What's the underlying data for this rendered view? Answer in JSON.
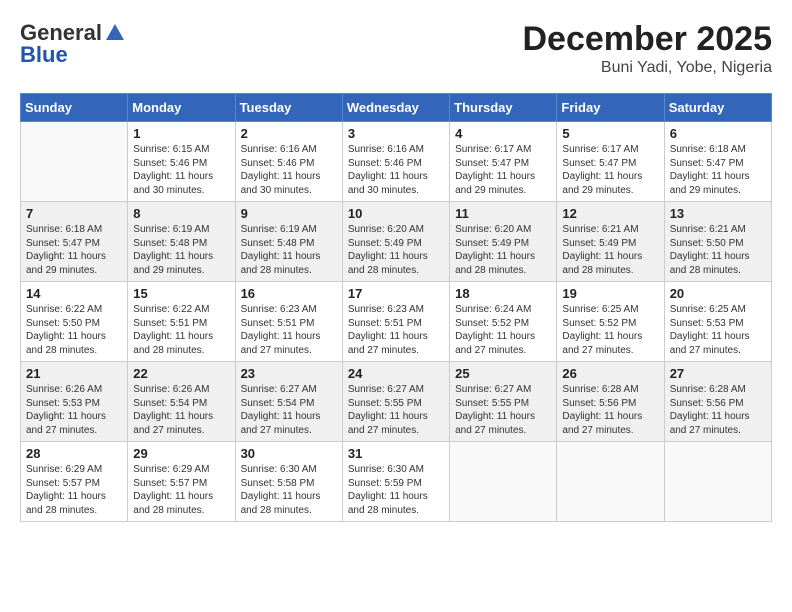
{
  "header": {
    "logo_general": "General",
    "logo_blue": "Blue",
    "title": "December 2025",
    "subtitle": "Buni Yadi, Yobe, Nigeria"
  },
  "weekdays": [
    "Sunday",
    "Monday",
    "Tuesday",
    "Wednesday",
    "Thursday",
    "Friday",
    "Saturday"
  ],
  "weeks": [
    [
      {
        "day": "",
        "empty": true
      },
      {
        "day": "1",
        "sunrise": "6:15 AM",
        "sunset": "5:46 PM",
        "daylight": "11 hours and 30 minutes."
      },
      {
        "day": "2",
        "sunrise": "6:16 AM",
        "sunset": "5:46 PM",
        "daylight": "11 hours and 30 minutes."
      },
      {
        "day": "3",
        "sunrise": "6:16 AM",
        "sunset": "5:46 PM",
        "daylight": "11 hours and 30 minutes."
      },
      {
        "day": "4",
        "sunrise": "6:17 AM",
        "sunset": "5:47 PM",
        "daylight": "11 hours and 29 minutes."
      },
      {
        "day": "5",
        "sunrise": "6:17 AM",
        "sunset": "5:47 PM",
        "daylight": "11 hours and 29 minutes."
      },
      {
        "day": "6",
        "sunrise": "6:18 AM",
        "sunset": "5:47 PM",
        "daylight": "11 hours and 29 minutes."
      }
    ],
    [
      {
        "day": "7",
        "sunrise": "6:18 AM",
        "sunset": "5:47 PM",
        "daylight": "11 hours and 29 minutes."
      },
      {
        "day": "8",
        "sunrise": "6:19 AM",
        "sunset": "5:48 PM",
        "daylight": "11 hours and 29 minutes."
      },
      {
        "day": "9",
        "sunrise": "6:19 AM",
        "sunset": "5:48 PM",
        "daylight": "11 hours and 28 minutes."
      },
      {
        "day": "10",
        "sunrise": "6:20 AM",
        "sunset": "5:49 PM",
        "daylight": "11 hours and 28 minutes."
      },
      {
        "day": "11",
        "sunrise": "6:20 AM",
        "sunset": "5:49 PM",
        "daylight": "11 hours and 28 minutes."
      },
      {
        "day": "12",
        "sunrise": "6:21 AM",
        "sunset": "5:49 PM",
        "daylight": "11 hours and 28 minutes."
      },
      {
        "day": "13",
        "sunrise": "6:21 AM",
        "sunset": "5:50 PM",
        "daylight": "11 hours and 28 minutes."
      }
    ],
    [
      {
        "day": "14",
        "sunrise": "6:22 AM",
        "sunset": "5:50 PM",
        "daylight": "11 hours and 28 minutes."
      },
      {
        "day": "15",
        "sunrise": "6:22 AM",
        "sunset": "5:51 PM",
        "daylight": "11 hours and 28 minutes."
      },
      {
        "day": "16",
        "sunrise": "6:23 AM",
        "sunset": "5:51 PM",
        "daylight": "11 hours and 27 minutes."
      },
      {
        "day": "17",
        "sunrise": "6:23 AM",
        "sunset": "5:51 PM",
        "daylight": "11 hours and 27 minutes."
      },
      {
        "day": "18",
        "sunrise": "6:24 AM",
        "sunset": "5:52 PM",
        "daylight": "11 hours and 27 minutes."
      },
      {
        "day": "19",
        "sunrise": "6:25 AM",
        "sunset": "5:52 PM",
        "daylight": "11 hours and 27 minutes."
      },
      {
        "day": "20",
        "sunrise": "6:25 AM",
        "sunset": "5:53 PM",
        "daylight": "11 hours and 27 minutes."
      }
    ],
    [
      {
        "day": "21",
        "sunrise": "6:26 AM",
        "sunset": "5:53 PM",
        "daylight": "11 hours and 27 minutes."
      },
      {
        "day": "22",
        "sunrise": "6:26 AM",
        "sunset": "5:54 PM",
        "daylight": "11 hours and 27 minutes."
      },
      {
        "day": "23",
        "sunrise": "6:27 AM",
        "sunset": "5:54 PM",
        "daylight": "11 hours and 27 minutes."
      },
      {
        "day": "24",
        "sunrise": "6:27 AM",
        "sunset": "5:55 PM",
        "daylight": "11 hours and 27 minutes."
      },
      {
        "day": "25",
        "sunrise": "6:27 AM",
        "sunset": "5:55 PM",
        "daylight": "11 hours and 27 minutes."
      },
      {
        "day": "26",
        "sunrise": "6:28 AM",
        "sunset": "5:56 PM",
        "daylight": "11 hours and 27 minutes."
      },
      {
        "day": "27",
        "sunrise": "6:28 AM",
        "sunset": "5:56 PM",
        "daylight": "11 hours and 27 minutes."
      }
    ],
    [
      {
        "day": "28",
        "sunrise": "6:29 AM",
        "sunset": "5:57 PM",
        "daylight": "11 hours and 28 minutes."
      },
      {
        "day": "29",
        "sunrise": "6:29 AM",
        "sunset": "5:57 PM",
        "daylight": "11 hours and 28 minutes."
      },
      {
        "day": "30",
        "sunrise": "6:30 AM",
        "sunset": "5:58 PM",
        "daylight": "11 hours and 28 minutes."
      },
      {
        "day": "31",
        "sunrise": "6:30 AM",
        "sunset": "5:59 PM",
        "daylight": "11 hours and 28 minutes."
      },
      {
        "day": "",
        "empty": true
      },
      {
        "day": "",
        "empty": true
      },
      {
        "day": "",
        "empty": true
      }
    ]
  ],
  "labels": {
    "sunrise": "Sunrise:",
    "sunset": "Sunset:",
    "daylight": "Daylight:"
  }
}
